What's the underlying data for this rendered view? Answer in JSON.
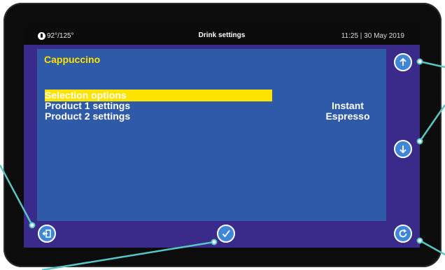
{
  "status": {
    "temperature": "92°/125°",
    "title": "Drink settings",
    "datetime": "11:25 | 30 May 2019"
  },
  "panel": {
    "title": "Cappuccino",
    "rows": [
      {
        "label": "Selection options",
        "value": "",
        "selected": true
      },
      {
        "label": "Product 1 settings",
        "value": "Instant",
        "selected": false
      },
      {
        "label": "Product 2 settings",
        "value": "Espresso",
        "selected": false
      }
    ]
  },
  "buttons": {
    "up": "up-arrow-icon",
    "down": "down-arrow-icon",
    "exit": "exit-icon",
    "confirm": "checkmark-icon",
    "refresh": "refresh-icon"
  },
  "colors": {
    "screen_bg": "#3a2a8a",
    "panel_bg": "#2f5aa8",
    "highlight": "#ffe300",
    "title": "#ffe100",
    "button": "#3f86d9"
  }
}
